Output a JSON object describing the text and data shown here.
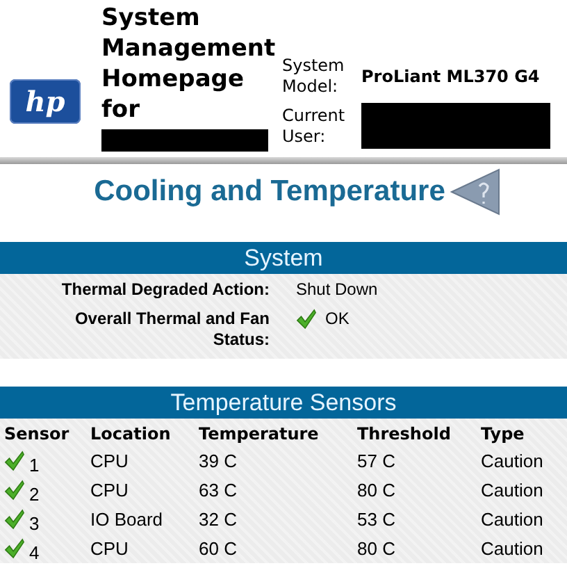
{
  "header": {
    "logo_text": "hp",
    "title": "System Management Homepage for",
    "title_redacted": true,
    "fields": [
      {
        "label": "System Model:",
        "value": "ProLiant ML370 G4",
        "redacted": false
      },
      {
        "label": "Current User:",
        "redacted": true
      }
    ]
  },
  "page_title": "Cooling and Temperature",
  "system": {
    "heading": "System",
    "rows": [
      {
        "label": "Thermal Degraded Action:",
        "value": "Shut Down",
        "kind": "text"
      },
      {
        "label": "Overall Thermal and Fan Status:",
        "value": "OK",
        "kind": "status",
        "ok": true
      }
    ]
  },
  "sensors": {
    "heading": "Temperature Sensors",
    "columns": [
      "Sensor",
      "Location",
      "Temperature",
      "Threshold",
      "Type"
    ],
    "rows": [
      {
        "ok": true,
        "sensor": "1",
        "location": "CPU",
        "temperature": "39 C",
        "threshold": "57 C",
        "type": "Caution"
      },
      {
        "ok": true,
        "sensor": "2",
        "location": "CPU",
        "temperature": "63 C",
        "threshold": "80 C",
        "type": "Caution"
      },
      {
        "ok": true,
        "sensor": "3",
        "location": "IO Board",
        "temperature": "32 C",
        "threshold": "53 C",
        "type": "Caution"
      },
      {
        "ok": true,
        "sensor": "4",
        "location": "CPU",
        "temperature": "60 C",
        "threshold": "80 C",
        "type": "Caution"
      }
    ]
  }
}
